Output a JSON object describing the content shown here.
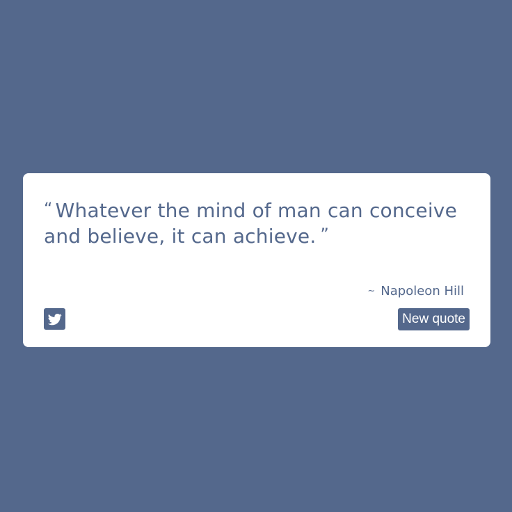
{
  "colors": {
    "background": "#54688c",
    "card": "#ffffff",
    "accent": "#54688c",
    "button_text": "#ffffff"
  },
  "quote": {
    "open_mark": "“",
    "text": "Whatever the mind of man can conceive and believe, it can achieve.",
    "close_mark": "”"
  },
  "author": {
    "prefix": "~",
    "name": "Napoleon Hill"
  },
  "actions": {
    "tweet_icon": "twitter-icon",
    "new_quote_label": "New quote"
  }
}
